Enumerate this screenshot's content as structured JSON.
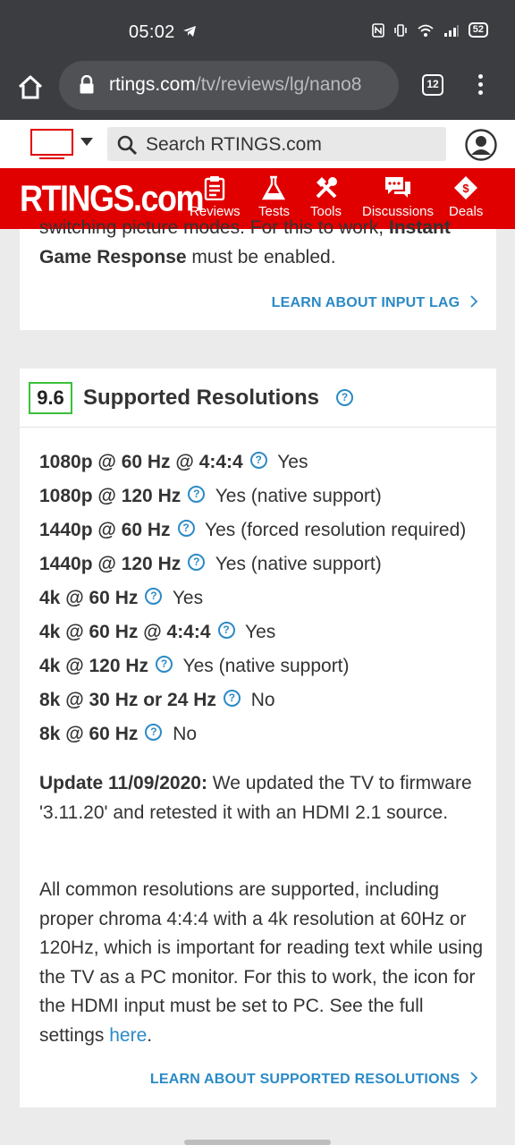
{
  "status": {
    "time": "05:02",
    "battery": "52"
  },
  "browser": {
    "url_host": "rtings.com",
    "url_path": "/tv/reviews/lg/nano8",
    "tab_count": "12"
  },
  "site": {
    "search_placeholder": "Search RTINGS.com",
    "logo": "RTINGS.com",
    "nav": [
      "Reviews",
      "Tests",
      "Tools",
      "Discussions",
      "Deals"
    ]
  },
  "card1": {
    "cut_text_start": "switching picture modes. For this to work, ",
    "cut_text_bold": "Instant",
    "line2_bold": "Game Response",
    "line2_rest": " must be enabled.",
    "link": "LEARN ABOUT INPUT LAG"
  },
  "card2": {
    "score": "9.6",
    "title": "Supported Resolutions",
    "rows": [
      {
        "label": "1080p @ 60 Hz @ 4:4:4",
        "value": "Yes"
      },
      {
        "label": "1080p @ 120 Hz",
        "value": "Yes (native support)"
      },
      {
        "label": "1440p @ 60 Hz",
        "value": "Yes (forced resolution required)"
      },
      {
        "label": "1440p @ 120 Hz",
        "value": "Yes (native support)"
      },
      {
        "label": "4k @ 60 Hz",
        "value": "Yes"
      },
      {
        "label": "4k @ 60 Hz @ 4:4:4",
        "value": "Yes"
      },
      {
        "label": "4k @ 120 Hz",
        "value": "Yes (native support)"
      },
      {
        "label": "8k @ 30 Hz or 24 Hz",
        "value": "No"
      },
      {
        "label": "8k @ 60 Hz",
        "value": "No"
      }
    ],
    "update_bold": "Update 11/09/2020:",
    "update_text": " We updated the TV to firmware '3.11.20' and retested it with an HDMI 2.1 source.",
    "body_text": "All common resolutions are supported, including proper chroma 4:4:4 with a 4k resolution at 60Hz or 120Hz, which is important for reading text while using the TV as a PC monitor. For this to work, the icon for the HDMI input must be set to PC. See the full settings ",
    "body_link": "here",
    "body_end": ".",
    "link": "LEARN ABOUT SUPPORTED RESOLUTIONS"
  },
  "colors": {
    "brand_red": "#e00000",
    "link_blue": "#2b8ac6",
    "score_green": "#3bbf3b"
  }
}
